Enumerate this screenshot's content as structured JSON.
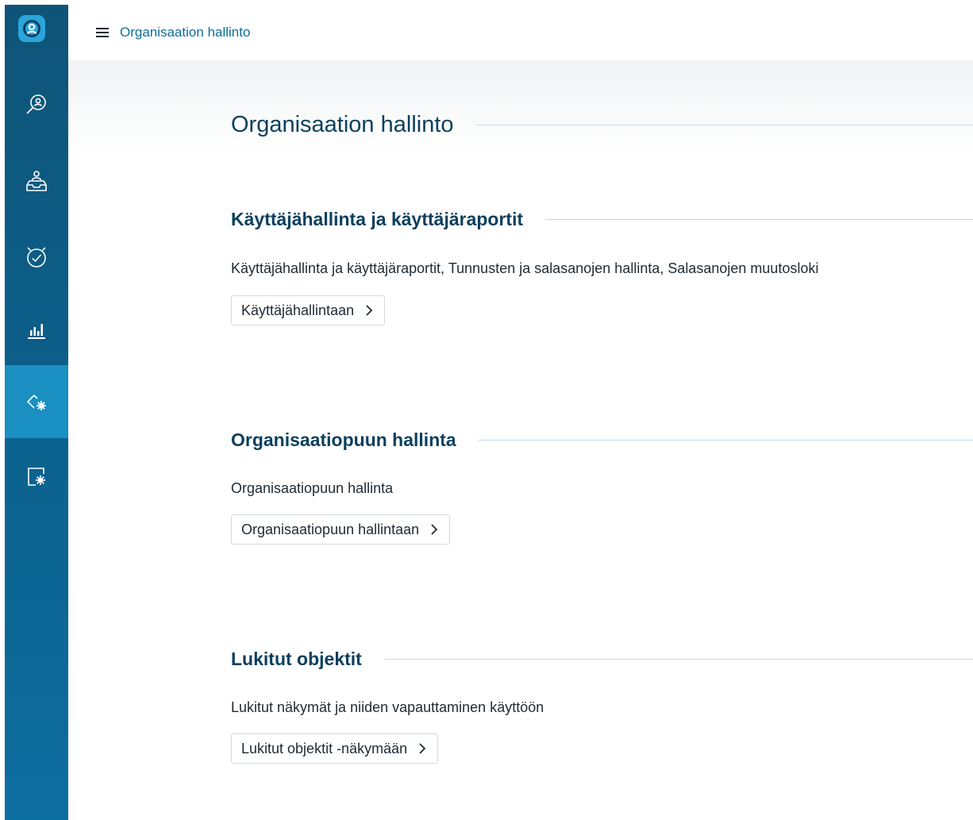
{
  "topbar": {
    "breadcrumb": "Organisaation hallinto",
    "menu_icon": "hamburger-icon"
  },
  "sidebar": {
    "logo_icon": "app-logo-icon",
    "items": [
      {
        "icon": "search-user-icon",
        "active": false
      },
      {
        "icon": "inbox-user-icon",
        "active": false
      },
      {
        "icon": "alarm-check-icon",
        "active": false
      },
      {
        "icon": "bar-chart-icon",
        "active": false
      },
      {
        "icon": "admin-settings-icon",
        "active": true
      },
      {
        "icon": "document-settings-icon",
        "active": false
      }
    ]
  },
  "main": {
    "title": "Organisaation hallinto",
    "sections": [
      {
        "title": "Käyttäjähallinta ja käyttäjäraportit",
        "description": "Käyttäjähallinta ja käyttäjäraportit, Tunnusten ja salasanojen hallinta, Salasanojen muutosloki",
        "button_label": "Käyttäjähallintaan"
      },
      {
        "title": "Organisaatiopuun hallinta",
        "description": "Organisaatiopuun hallinta",
        "button_label": "Organisaatiopuun hallintaan"
      },
      {
        "title": "Lukitut objektit",
        "description": "Lukitut näkymät ja niiden vapauttaminen käyttöön",
        "button_label": "Lukitut objektit -näkymään"
      }
    ]
  },
  "colors": {
    "sidebar": "#0c5f8a",
    "sidebar_active": "#1a8fc2",
    "logo": "#2aa5dc",
    "heading": "#0b3f5e",
    "link": "#0e6f9c"
  }
}
